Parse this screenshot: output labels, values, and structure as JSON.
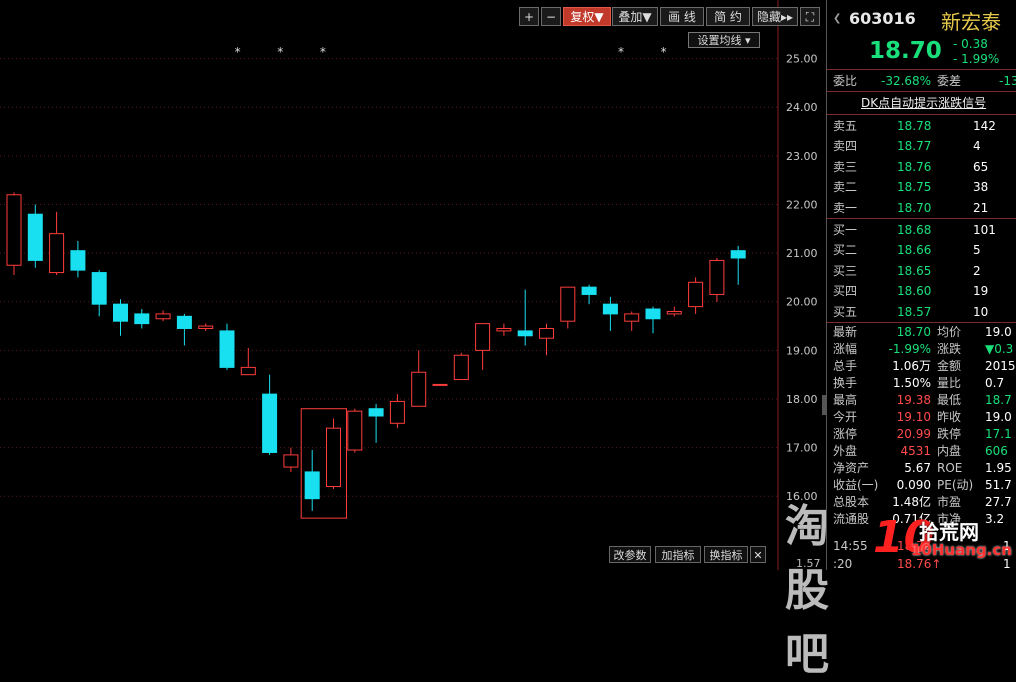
{
  "toolbar": {
    "plus": "+",
    "minus": "−",
    "fuquan": "复权▼",
    "diejia": "叠加▼",
    "huaxian": "画 线",
    "jianyue": "简 约",
    "yincang": "隐藏▸▸",
    "fullscreen": "⛶",
    "set_avg": "设置均线 ▾"
  },
  "bottom_buttons": {
    "params": "改参数",
    "add_indicator": "加指标",
    "switch_indicator": "换指标",
    "close": "✕"
  },
  "axis_bottom_value": "1.57",
  "stock": {
    "code": "603016",
    "name": "新宏泰",
    "price": "18.70",
    "change": "- 0.38",
    "change_pct": "- 1.99%"
  },
  "summary": {
    "weibi_label": "委比",
    "weibi_value": "-32.68%",
    "weicha_label": "委差",
    "weicha_value": "-13",
    "dk_link": "DK点自动提示涨跌信号"
  },
  "sell_orders": [
    {
      "label": "卖五",
      "price": "18.78",
      "volume": "142"
    },
    {
      "label": "卖四",
      "price": "18.77",
      "volume": "4"
    },
    {
      "label": "卖三",
      "price": "18.76",
      "volume": "65"
    },
    {
      "label": "卖二",
      "price": "18.75",
      "volume": "38"
    },
    {
      "label": "卖一",
      "price": "18.70",
      "volume": "21"
    }
  ],
  "buy_orders": [
    {
      "label": "买一",
      "price": "18.68",
      "volume": "101"
    },
    {
      "label": "买二",
      "price": "18.66",
      "volume": "5"
    },
    {
      "label": "买三",
      "price": "18.65",
      "volume": "2"
    },
    {
      "label": "买四",
      "price": "18.60",
      "volume": "19"
    },
    {
      "label": "买五",
      "price": "18.57",
      "volume": "10"
    }
  ],
  "stats": [
    {
      "l1": "最新",
      "v1": "18.70",
      "c1": "green",
      "l2": "均价",
      "v2": "19.0",
      "c2": "white"
    },
    {
      "l1": "涨幅",
      "v1": "-1.99%",
      "c1": "green",
      "l2": "涨跌",
      "v2": "▼0.3",
      "c2": "green"
    },
    {
      "l1": "总手",
      "v1": "1.06万",
      "c1": "white",
      "l2": "金额",
      "v2": "2015",
      "c2": "white"
    },
    {
      "l1": "换手",
      "v1": "1.50%",
      "c1": "white",
      "l2": "量比",
      "v2": "0.7",
      "c2": "white"
    },
    {
      "l1": "最高",
      "v1": "19.38",
      "c1": "red",
      "l2": "最低",
      "v2": "18.7",
      "c2": "green"
    },
    {
      "l1": "今开",
      "v1": "19.10",
      "c1": "red",
      "l2": "昨收",
      "v2": "19.0",
      "c2": "white"
    },
    {
      "l1": "涨停",
      "v1": "20.99",
      "c1": "red",
      "l2": "跌停",
      "v2": "17.1",
      "c2": "green"
    },
    {
      "l1": "外盘",
      "v1": "4531",
      "c1": "red",
      "l2": "内盘",
      "v2": "606",
      "c2": "green"
    },
    {
      "l1": "净资产",
      "v1": "5.67",
      "c1": "white",
      "l2": "ROE",
      "v2": "1.95",
      "c2": "white"
    },
    {
      "l1": "收益(一)",
      "v1": "0.090",
      "c1": "white",
      "l2": "PE(动)",
      "v2": "51.7",
      "c2": "white"
    },
    {
      "l1": "总股本",
      "v1": "1.48亿",
      "c1": "white",
      "l2": "市盈",
      "v2": "27.7",
      "c2": "white"
    },
    {
      "l1": "流通股",
      "v1": "0.71亿",
      "c1": "white",
      "l2": "市净",
      "v2": "3.2",
      "c2": "white"
    }
  ],
  "ticks": [
    {
      "time": "14:55",
      "price": "18.76",
      "vol": "1"
    },
    {
      "time": ":20",
      "price": "18.76↑",
      "vol": "1"
    }
  ],
  "watermark": {
    "main": "淘股吧",
    "site": "拾荒网",
    "domain": "10Huang.cn"
  },
  "chart_data": {
    "type": "candlestick",
    "yticks": [
      "25.00",
      "24.00",
      "23.00",
      "22.00",
      "21.00",
      "20.00",
      "19.00",
      "18.00",
      "17.00",
      "16.00"
    ],
    "ylim": [
      15.1,
      26.0
    ],
    "up_color": "#ff3c3c",
    "down_color": "#19e0f0",
    "candles": [
      {
        "o": 20.75,
        "h": 22.25,
        "l": 20.55,
        "c": 22.2
      },
      {
        "o": 21.8,
        "h": 22.0,
        "l": 20.7,
        "c": 20.85
      },
      {
        "o": 20.6,
        "h": 21.85,
        "l": 20.55,
        "c": 21.4
      },
      {
        "o": 21.05,
        "h": 21.25,
        "l": 20.5,
        "c": 20.65
      },
      {
        "o": 20.6,
        "h": 20.65,
        "l": 19.7,
        "c": 19.95
      },
      {
        "o": 19.95,
        "h": 20.05,
        "l": 19.3,
        "c": 19.6
      },
      {
        "o": 19.75,
        "h": 19.85,
        "l": 19.45,
        "c": 19.55
      },
      {
        "o": 19.65,
        "h": 19.82,
        "l": 19.6,
        "c": 19.75
      },
      {
        "o": 19.7,
        "h": 19.75,
        "l": 19.1,
        "c": 19.45
      },
      {
        "o": 19.45,
        "h": 19.55,
        "l": 19.4,
        "c": 19.5
      },
      {
        "o": 19.4,
        "h": 19.55,
        "l": 18.6,
        "c": 18.65
      },
      {
        "o": 18.5,
        "h": 19.05,
        "l": 18.5,
        "c": 18.65
      },
      {
        "o": 18.1,
        "h": 18.5,
        "l": 16.85,
        "c": 16.9
      },
      {
        "o": 16.6,
        "h": 17.0,
        "l": 16.5,
        "c": 16.85
      },
      {
        "o": 16.5,
        "h": 16.95,
        "l": 15.7,
        "c": 15.95
      },
      {
        "o": 16.2,
        "h": 17.6,
        "l": 16.15,
        "c": 17.4
      },
      {
        "o": 16.95,
        "h": 17.8,
        "l": 16.9,
        "c": 17.75
      },
      {
        "o": 17.8,
        "h": 17.9,
        "l": 17.1,
        "c": 17.65
      },
      {
        "o": 17.5,
        "h": 18.1,
        "l": 17.4,
        "c": 17.95
      },
      {
        "o": 17.85,
        "h": 19.0,
        "l": 17.85,
        "c": 18.55
      },
      {
        "o": 18.3,
        "h": 18.3,
        "l": 18.3,
        "c": 18.3
      },
      {
        "o": 18.4,
        "h": 18.95,
        "l": 18.4,
        "c": 18.9
      },
      {
        "o": 19.0,
        "h": 19.55,
        "l": 18.6,
        "c": 19.55
      },
      {
        "o": 19.4,
        "h": 19.55,
        "l": 19.3,
        "c": 19.45
      },
      {
        "o": 19.4,
        "h": 20.25,
        "l": 19.1,
        "c": 19.3
      },
      {
        "o": 19.25,
        "h": 19.55,
        "l": 18.9,
        "c": 19.45
      },
      {
        "o": 19.6,
        "h": 20.3,
        "l": 19.45,
        "c": 20.3
      },
      {
        "o": 20.3,
        "h": 20.35,
        "l": 19.95,
        "c": 20.15
      },
      {
        "o": 19.95,
        "h": 20.1,
        "l": 19.4,
        "c": 19.75
      },
      {
        "o": 19.6,
        "h": 19.8,
        "l": 19.4,
        "c": 19.75
      },
      {
        "o": 19.85,
        "h": 19.9,
        "l": 19.35,
        "c": 19.65
      },
      {
        "o": 19.75,
        "h": 19.9,
        "l": 19.7,
        "c": 19.8
      },
      {
        "o": 19.9,
        "h": 20.5,
        "l": 19.75,
        "c": 20.4
      },
      {
        "o": 20.15,
        "h": 20.9,
        "l": 20.0,
        "c": 20.85
      },
      {
        "o": 21.05,
        "h": 21.15,
        "l": 20.35,
        "c": 20.9
      }
    ],
    "star_indices": [
      5,
      7,
      9,
      19,
      21
    ],
    "highlight_box": {
      "from_index": 14,
      "to_index": 15,
      "low": 15.55,
      "high": 17.8
    }
  }
}
